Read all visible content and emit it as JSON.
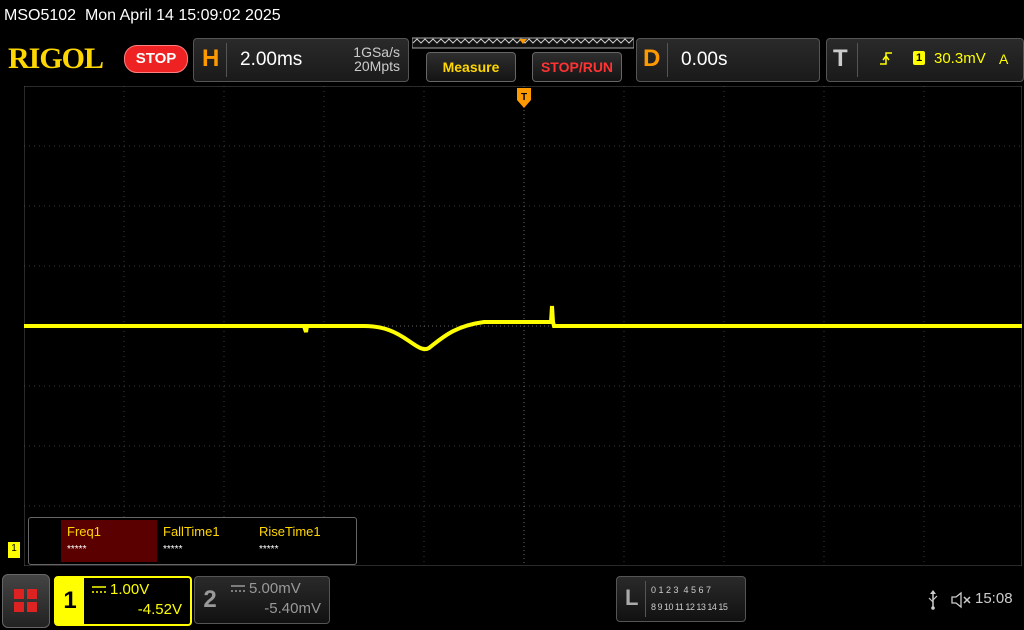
{
  "status_bar": {
    "model": "MSO5102",
    "datetime": "Mon April 14 15:09:02 2025"
  },
  "logo": "RIGOL",
  "run_state": "STOP",
  "horizontal": {
    "letter": "H",
    "timebase": "2.00ms",
    "sample_rate": "1GSa/s",
    "memory_depth": "20Mpts"
  },
  "buttons": {
    "measure": "Measure",
    "stop_run": "STOP/RUN"
  },
  "delay": {
    "letter": "D",
    "value": "0.00s"
  },
  "trigger": {
    "letter": "T",
    "source": "1",
    "level": "30.3mV",
    "mode": "A"
  },
  "measurements": [
    {
      "name": "Freq1",
      "value": "*****"
    },
    {
      "name": "FallTime1",
      "value": "*****"
    },
    {
      "name": "RiseTime1",
      "value": "*****"
    }
  ],
  "channel_marker": "1",
  "channels": [
    {
      "number": "1",
      "scale": "1.00V",
      "offset": "-4.52V",
      "color": "#ffff00"
    },
    {
      "number": "2",
      "scale": "5.00mV",
      "offset": "-5.40mV",
      "color": "#00ffff"
    }
  ],
  "logic": {
    "letter": "L",
    "row1": "0 1 2 3  4 5 6 7",
    "row2": "8 9 10 11 12 13 14 15"
  },
  "clock": "15:08",
  "colors": {
    "trace": "#ffff00",
    "horizontal": "#ff9900",
    "stop": "#ee2222",
    "measure": "#ffd700",
    "stop_run": "#ff3333"
  }
}
